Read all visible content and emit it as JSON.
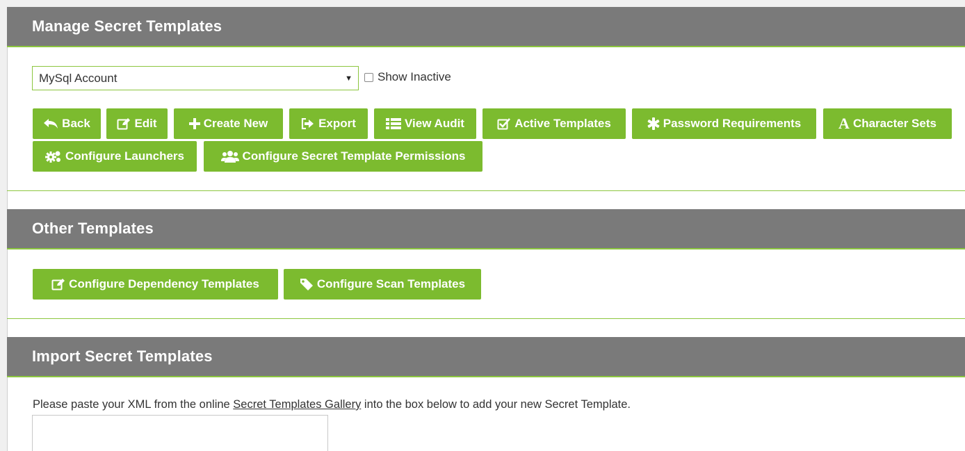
{
  "manage": {
    "title": "Manage Secret Templates",
    "template_select": {
      "value": "MySql Account"
    },
    "show_inactive_label": "Show Inactive",
    "buttons": {
      "back": "Back",
      "edit": "Edit",
      "create_new": "Create New",
      "export": "Export",
      "view_audit": "View Audit",
      "active_templates": "Active Templates",
      "password_requirements": "Password Requirements",
      "character_sets": "Character Sets",
      "configure_launchers": "Configure Launchers",
      "configure_permissions": "Configure Secret Template Permissions"
    }
  },
  "other": {
    "title": "Other Templates",
    "buttons": {
      "dependency": "Configure Dependency Templates",
      "scan": "Configure Scan Templates"
    }
  },
  "import": {
    "title": "Import Secret Templates",
    "instructions_before": "Please paste your XML from the online ",
    "gallery_link": "Secret Templates Gallery",
    "instructions_after": " into the box below to add your new Secret Template."
  },
  "colors": {
    "header_bg": "#7a7a7a",
    "accent_green": "#8cc63f",
    "button_green": "#7cbb2f"
  }
}
